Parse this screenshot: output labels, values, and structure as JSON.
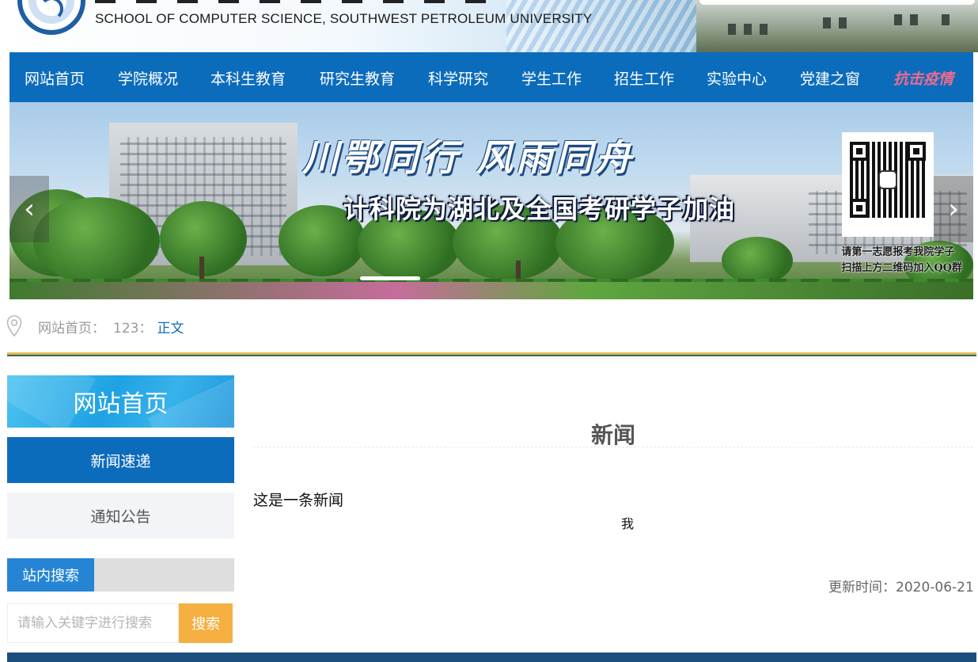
{
  "header": {
    "school_name": "SCHOOL OF COMPUTER SCIENCE, SOUTHWEST PETROLEUM UNIVERSITY"
  },
  "nav": {
    "items": [
      {
        "label": "网站首页"
      },
      {
        "label": "学院概况"
      },
      {
        "label": "本科生教育"
      },
      {
        "label": "研究生教育"
      },
      {
        "label": "科学研究"
      },
      {
        "label": "学生工作"
      },
      {
        "label": "招生工作"
      },
      {
        "label": "实验中心"
      },
      {
        "label": "党建之窗"
      },
      {
        "label": "抗击疫情"
      }
    ],
    "special_color": "#f06a8e",
    "bar_color": "#0c6cbc"
  },
  "banner": {
    "slogan_line1": "川鄂同行 风雨同舟",
    "slogan_line2": "计科院为湖北及全国考研学子加油",
    "qr_note_line1": "请第一志愿报考我院学子",
    "qr_note_line2": "扫描上方二维码加入QQ群",
    "prev_arrow": "‹",
    "next_arrow": "›"
  },
  "breadcrumb": {
    "home": "网站首页：",
    "section": "123：",
    "current": "正文"
  },
  "sidebar": {
    "title": "网站首页",
    "items": [
      {
        "label": "新闻速递",
        "active": true
      },
      {
        "label": "通知公告",
        "active": false
      }
    ],
    "search": {
      "title": "站内搜索",
      "placeholder": "请输入关键字进行搜索",
      "button": "搜索"
    }
  },
  "article": {
    "title": "新闻",
    "body": "这是一条新闻",
    "body_extra": "我",
    "updated": "更新时间：2020-06-21"
  },
  "colors": {
    "primary": "#0c6cbc",
    "accent": "#f5b041",
    "rule": "#e8b94c"
  }
}
